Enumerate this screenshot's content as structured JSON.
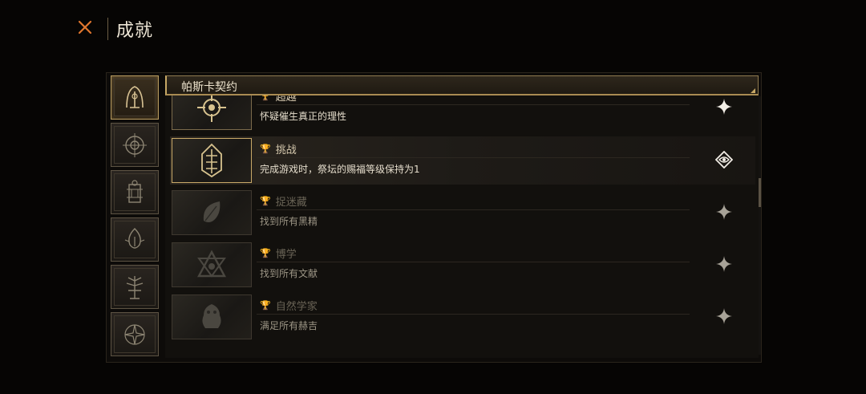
{
  "header": {
    "title": "成就",
    "close_icon": "close-x-icon"
  },
  "sidebar": {
    "tabs": [
      {
        "icon": "arch-sigil-icon",
        "active": true
      },
      {
        "icon": "compass-sigil-icon",
        "active": false
      },
      {
        "icon": "scroll-sigil-icon",
        "active": false
      },
      {
        "icon": "flame-sigil-icon",
        "active": false
      },
      {
        "icon": "tree-sigil-icon",
        "active": false
      },
      {
        "icon": "star-sigil-icon",
        "active": false
      }
    ]
  },
  "list": {
    "header_title": "帕斯卡契约",
    "achievements": [
      {
        "name": "超越",
        "description": "怀疑催生真正的理性",
        "icon": "compass-emblem-icon",
        "state": "unlocked",
        "status_icon": "sparkle-icon"
      },
      {
        "name": "挑战",
        "description": "完成游戏时，祭坛的赐福等级保持为1",
        "icon": "rune-emblem-icon",
        "state": "featured",
        "status_icon": "eye-sigil-icon"
      },
      {
        "name": "捉迷藏",
        "description": "找到所有黑精",
        "icon": "leaf-emblem-icon",
        "state": "locked",
        "status_icon": "sparkle-icon"
      },
      {
        "name": "博学",
        "description": "找到所有文献",
        "icon": "triangle-eye-emblem-icon",
        "state": "locked",
        "status_icon": "sparkle-icon"
      },
      {
        "name": "自然学家",
        "description": "满足所有赫吉",
        "icon": "creature-emblem-icon",
        "state": "locked",
        "status_icon": "sparkle-icon"
      }
    ]
  },
  "colors": {
    "accent_gold": "#c7a865",
    "background": "#060504",
    "close_orange": "#e0762e"
  }
}
